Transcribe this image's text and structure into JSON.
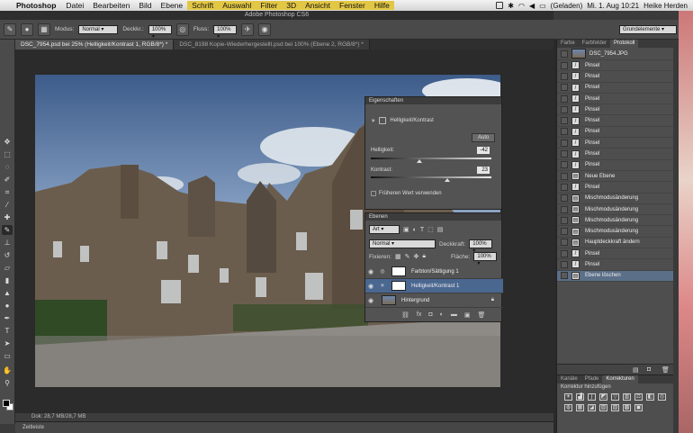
{
  "menubar": {
    "app": "Photoshop",
    "items": [
      "Datei",
      "Bearbeiten",
      "Bild",
      "Ebene",
      "Schrift",
      "Auswahl",
      "Filter",
      "3D",
      "Ansicht",
      "Fenster",
      "Hilfe"
    ],
    "highlighted": [
      "Schrift",
      "Auswahl",
      "Filter",
      "3D",
      "Ansicht",
      "Fenster",
      "Hilfe"
    ],
    "battery": "(Geladen)",
    "datetime": "Mi. 1. Aug 10:21",
    "user": "Heike Herden"
  },
  "window": {
    "title": "Adobe Photoshop CS6"
  },
  "options": {
    "modus_label": "Modus:",
    "modus_value": "Normal",
    "deckkr_label": "Deckkr.:",
    "deckkr_value": "100%",
    "fluss_label": "Fluss:",
    "fluss_value": "100%",
    "workspace": "Grundelemente"
  },
  "tabs": [
    {
      "label": "DSC_7954.psd bei 25% (Helligkeit/Kontrast 1, RGB/8*) *",
      "active": true
    },
    {
      "label": "DSC_8198 Kopie-Wiederhergestellt.psd bei 100% (Ebene 2, RGB/8*) *",
      "active": false
    }
  ],
  "properties": {
    "title": "Eigenschaften",
    "subtitle": "Helligkeit/Kontrast",
    "auto": "Auto",
    "helligkeit_label": "Helligkeit:",
    "helligkeit_value": "-42",
    "kontrast_label": "Kontrast:",
    "kontrast_value": "23",
    "legacy_label": "Früheren Wert verwenden"
  },
  "layers": {
    "title": "Ebenen",
    "filter": "Art",
    "blend": "Normal",
    "opacity_label": "Deckkraft:",
    "opacity_value": "100%",
    "lock_label": "Fixieren:",
    "fill_label": "Fläche:",
    "fill_value": "100%",
    "items": [
      {
        "name": "Farbton/Sättigung 1",
        "selected": false
      },
      {
        "name": "Helligkeit/Kontrast 1",
        "selected": true
      },
      {
        "name": "Hintergrund",
        "selected": false
      }
    ]
  },
  "history": {
    "tabs": [
      "Farbe",
      "Farbfelder",
      "Protokoll"
    ],
    "active_tab": "Protokoll",
    "snapshot": "DSC_7954.JPG",
    "items": [
      "Pinsel",
      "Pinsel",
      "Pinsel",
      "Pinsel",
      "Pinsel",
      "Pinsel",
      "Pinsel",
      "Pinsel",
      "Pinsel",
      "Pinsel",
      "Neue Ebene",
      "Pinsel",
      "Mischmodusänderung",
      "Mischmodusänderung",
      "Mischmodusänderung",
      "Mischmodusänderung",
      "Hauptdeckkraft ändern",
      "Pinsel",
      "Pinsel",
      "Ebene löschen"
    ],
    "selected_index": 19
  },
  "corrections": {
    "tabs": [
      "Kanäle",
      "Pfade",
      "Korrekturen"
    ],
    "active_tab": "Korrekturen",
    "heading": "Korrektur hinzufügen"
  },
  "status": {
    "doc": "Dok: 28,7 MB/28,7 MB",
    "timeline": "Zeitleiste"
  }
}
